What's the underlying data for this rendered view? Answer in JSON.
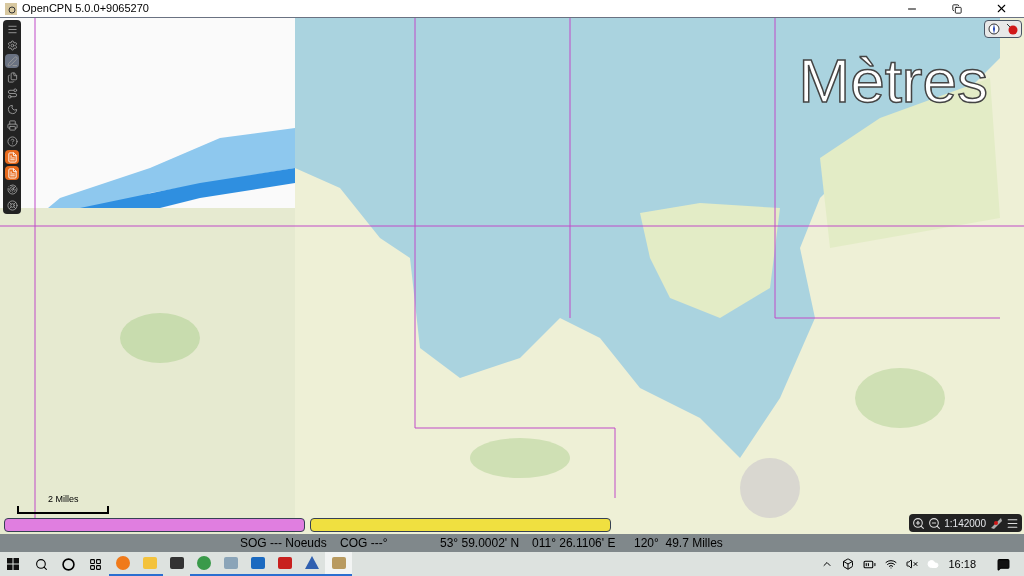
{
  "window": {
    "title": "OpenCPN 5.0.0+9065270"
  },
  "toolbar": [
    {
      "kind": "menu",
      "on": false
    },
    {
      "kind": "settings",
      "on": false
    },
    {
      "kind": "pencil",
      "on": true
    },
    {
      "kind": "pages",
      "on": false
    },
    {
      "kind": "route",
      "on": false
    },
    {
      "kind": "night",
      "on": false
    },
    {
      "kind": "print",
      "on": false
    },
    {
      "kind": "help",
      "on": false
    },
    {
      "kind": "layer",
      "on": true
    },
    {
      "kind": "layer",
      "on": true
    },
    {
      "kind": "ais",
      "on": false
    },
    {
      "kind": "lifebuoy",
      "on": false
    }
  ],
  "units_label": "Mètres",
  "scale_bar": {
    "label": "2 Milles"
  },
  "chart_bars": [
    {
      "color": "#e07ee0"
    },
    {
      "color": "#f0e040"
    }
  ],
  "zoom_widget": {
    "scale": "1:142000"
  },
  "status_bar": {
    "sog": "SOG --- Noeuds",
    "cog": "COG ---°",
    "lat": "53° 59.0002' N",
    "lon": "011° 26.1106' E",
    "bearing": "120°  49.7 Milles"
  },
  "taskbar": {
    "apps": [
      {
        "kind": "firefox",
        "running": true,
        "selected": false
      },
      {
        "kind": "explorer",
        "running": true,
        "selected": false
      },
      {
        "kind": "store",
        "running": false,
        "selected": false
      },
      {
        "kind": "chrome",
        "running": true,
        "selected": false
      },
      {
        "kind": "monitor",
        "running": true,
        "selected": false
      },
      {
        "kind": "outlook",
        "running": true,
        "selected": false
      },
      {
        "kind": "acrobat",
        "running": true,
        "selected": false
      },
      {
        "kind": "vpn",
        "running": true,
        "selected": false
      },
      {
        "kind": "opencpn",
        "running": true,
        "selected": true
      }
    ],
    "clock": "16:18"
  }
}
